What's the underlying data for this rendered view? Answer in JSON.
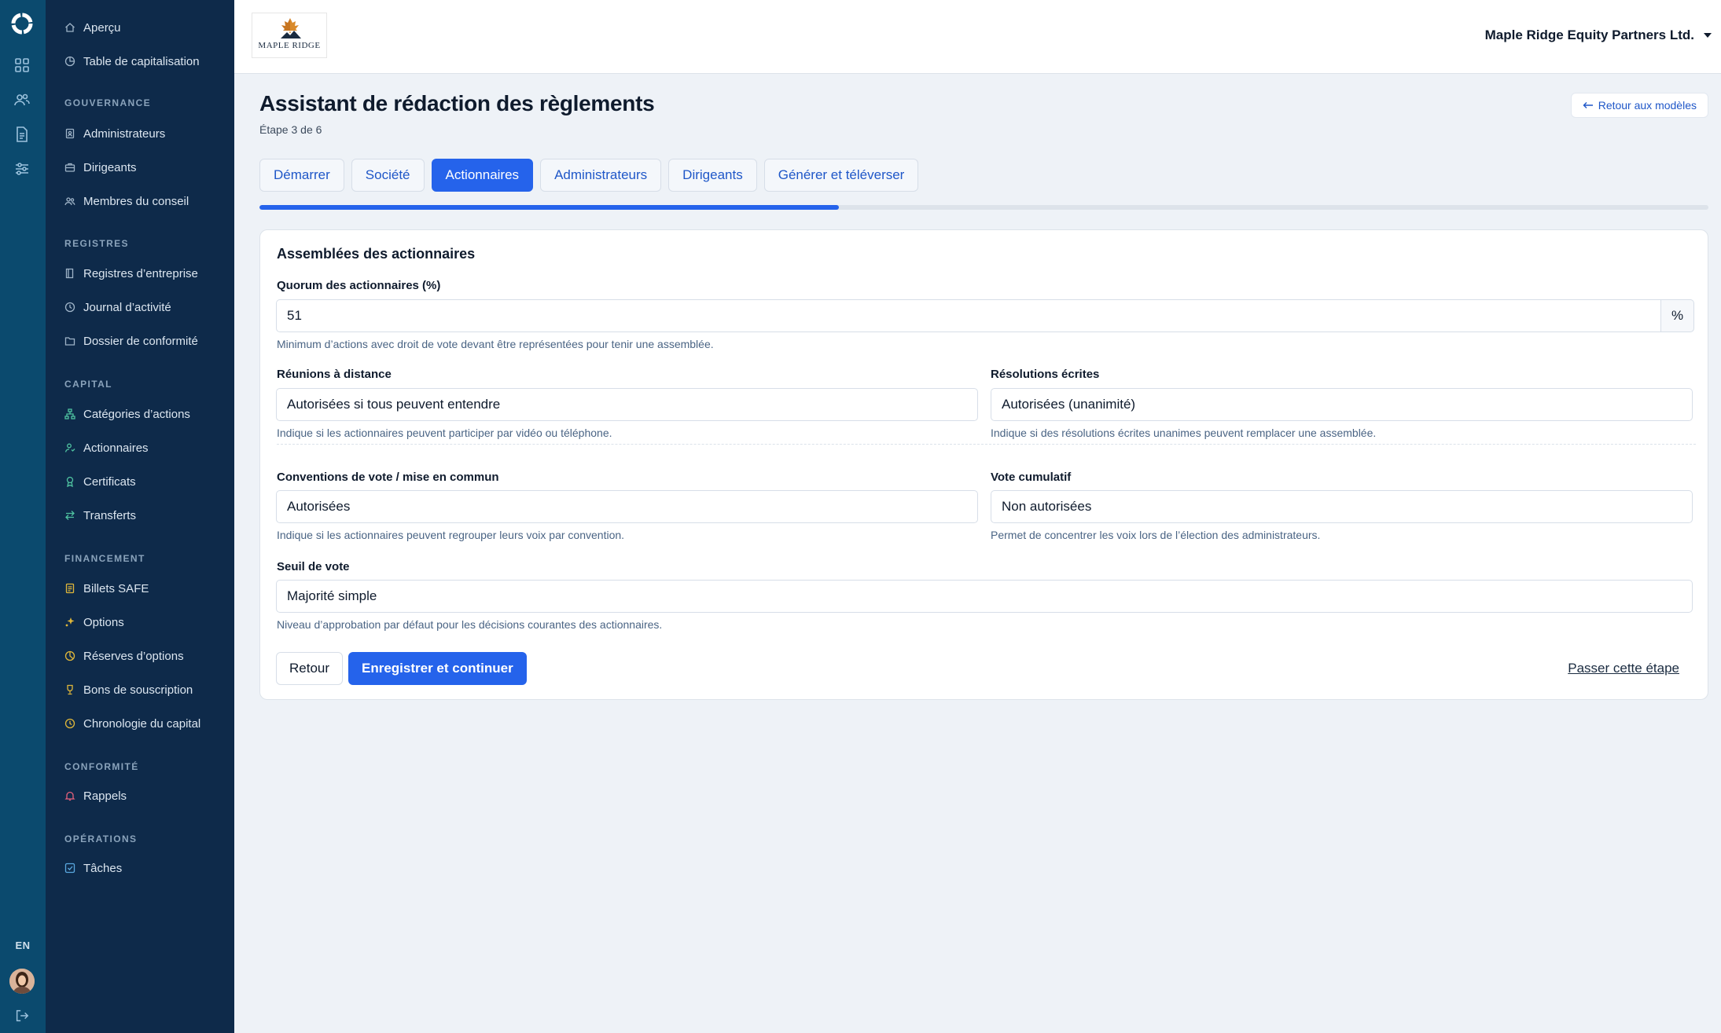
{
  "rail": {
    "icons": [
      "dashboard-icon",
      "users-icon",
      "document-icon",
      "sliders-icon"
    ],
    "lang": "EN"
  },
  "sidebar": {
    "top_items": [
      {
        "label": "Aperçu",
        "icon": "home-icon"
      },
      {
        "label": "Table de capitalisation",
        "icon": "pie-chart-icon"
      }
    ],
    "sections": [
      {
        "heading": "GOUVERNANCE",
        "items": [
          {
            "label": "Administrateurs",
            "icon": "id-badge-icon"
          },
          {
            "label": "Dirigeants",
            "icon": "briefcase-icon"
          },
          {
            "label": "Membres du conseil",
            "icon": "group-icon"
          }
        ]
      },
      {
        "heading": "REGISTRES",
        "items": [
          {
            "label": "Registres d’entreprise",
            "icon": "book-icon"
          },
          {
            "label": "Journal d’activité",
            "icon": "clock-icon"
          },
          {
            "label": "Dossier de conformité",
            "icon": "folder-icon"
          }
        ]
      },
      {
        "heading": "CAPITAL",
        "items": [
          {
            "label": "Catégories d’actions",
            "icon": "hierarchy-icon"
          },
          {
            "label": "Actionnaires",
            "icon": "shareholder-icon"
          },
          {
            "label": "Certificats",
            "icon": "award-icon"
          },
          {
            "label": "Transferts",
            "icon": "transfer-icon"
          }
        ]
      },
      {
        "heading": "FINANCEMENT",
        "items": [
          {
            "label": "Billets SAFE",
            "icon": "note-icon"
          },
          {
            "label": "Options",
            "icon": "sparkle-icon"
          },
          {
            "label": "Réserves d’options",
            "icon": "pie-chart-icon"
          },
          {
            "label": "Bons de souscription",
            "icon": "trophy-icon"
          },
          {
            "label": "Chronologie du capital",
            "icon": "timeline-icon"
          }
        ]
      },
      {
        "heading": "CONFORMITÉ",
        "items": [
          {
            "label": "Rappels",
            "icon": "bell-icon"
          }
        ]
      },
      {
        "heading": "OPÉRATIONS",
        "items": [
          {
            "label": "Tâches",
            "icon": "checkbox-icon"
          }
        ]
      }
    ]
  },
  "topbar": {
    "logo_text": "MAPLE RIDGE",
    "company": "Maple Ridge Equity Partners Ltd."
  },
  "page": {
    "title": "Assistant de rédaction des règlements",
    "step": "Étape 3 de 6",
    "back_to_templates": "Retour aux modèles"
  },
  "tabs": [
    {
      "label": "Démarrer",
      "active": false
    },
    {
      "label": "Société",
      "active": false
    },
    {
      "label": "Actionnaires",
      "active": true
    },
    {
      "label": "Administrateurs",
      "active": false
    },
    {
      "label": "Dirigeants",
      "active": false
    },
    {
      "label": "Générer et téléverser",
      "active": false
    }
  ],
  "progress": {
    "fraction": 0.4
  },
  "form": {
    "section_title": "Assemblées des actionnaires",
    "quorum": {
      "label": "Quorum des actionnaires (%)",
      "value": "51",
      "suffix": "%",
      "hint": "Minimum d’actions avec droit de vote devant être représentées pour tenir une assemblée."
    },
    "remote": {
      "label": "Réunions à distance",
      "value": "Autorisées si tous peuvent entendre",
      "hint": "Indique si les actionnaires peuvent participer par vidéo ou téléphone."
    },
    "written": {
      "label": "Résolutions écrites",
      "value": "Autorisées (unanimité)",
      "hint": "Indique si des résolutions écrites unanimes peuvent remplacer une assemblée."
    },
    "voting_agreements": {
      "label": "Conventions de vote / mise en commun",
      "value": "Autorisées",
      "hint": "Indique si les actionnaires peuvent regrouper leurs voix par convention."
    },
    "cumulative": {
      "label": "Vote cumulatif",
      "value": "Non autorisées",
      "hint": "Permet de concentrer les voix lors de l’élection des administrateurs."
    },
    "threshold": {
      "label": "Seuil de vote",
      "value": "Majorité simple",
      "hint": "Niveau d’approbation par défaut pour les décisions courantes des actionnaires."
    }
  },
  "actions": {
    "back": "Retour",
    "save": "Enregistrer et continuer",
    "skip": "Passer cette étape"
  },
  "colors": {
    "rail": "#0b4a6e",
    "sidebar": "#0e2a4a",
    "accent": "#2563eb"
  }
}
